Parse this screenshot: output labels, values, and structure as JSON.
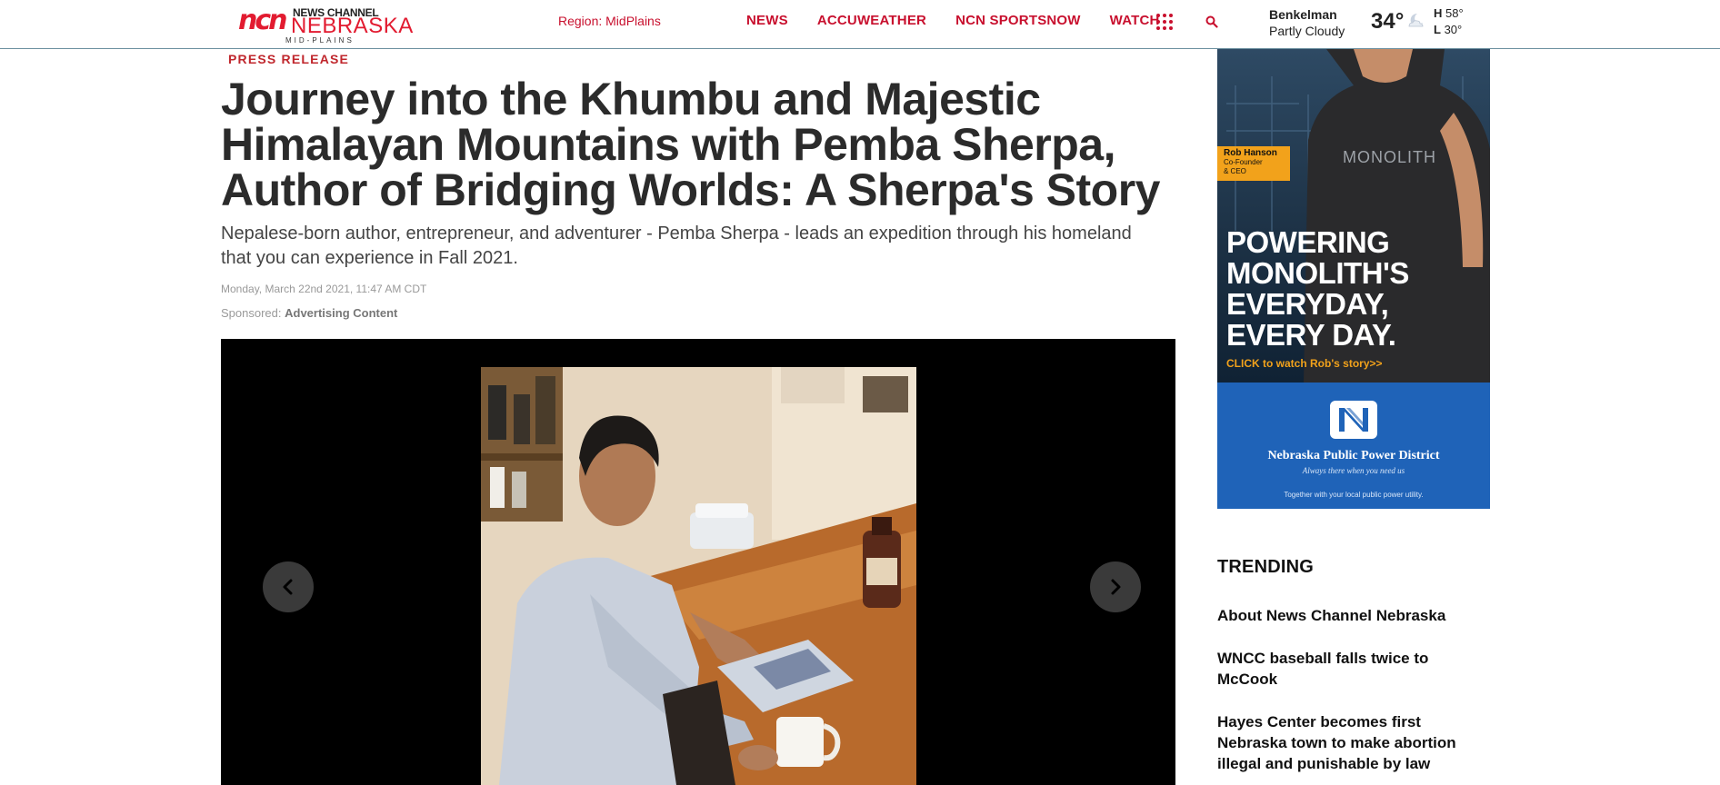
{
  "header": {
    "logo": {
      "mark": "ncn",
      "line1": "NEWS CHANNEL",
      "line2": "NEBRASKA",
      "line3": "MID-PLAINS"
    },
    "region_label": "Region: MidPlains",
    "nav": [
      "NEWS",
      "ACCUWEATHER",
      "NCN SPORTSNOW",
      "WATCH"
    ],
    "icons": {
      "apps": "grid-dots-icon",
      "search": "search-icon",
      "weather": "partly-cloudy-night-icon"
    },
    "weather": {
      "city": "Benkelman",
      "condition": "Partly Cloudy",
      "temp": "34°",
      "high": "58°",
      "low": "30°",
      "high_label": "H",
      "low_label": "L"
    }
  },
  "article": {
    "kicker": "PRESS RELEASE",
    "headline": "Journey into the Khumbu and Majestic Himalayan Mountains with Pemba Sherpa, Author of Bridging Worlds: A Sherpa's Story",
    "subhead": "Nepalese-born author, entrepreneur, and adventurer - Pemba Sherpa - leads an expedition through his homeland that you can experience in Fall 2021.",
    "date": "Monday, March 22nd 2021, 11:47 AM CDT",
    "sponsored_label": "Sponsored:",
    "sponsored_value": "Advertising Content"
  },
  "ad": {
    "person_name": "Rob Hanson",
    "person_role_1": "Co-Founder",
    "person_role_2": "& CEO",
    "shirt_text": "MONOLITH",
    "headline_1": "POWERING",
    "headline_2": "MONOLITH'S",
    "headline_3": "EVERYDAY,",
    "headline_4": "EVERY DAY.",
    "cta": "CLICK to watch Rob's story>>",
    "org_name": "Nebraska Public Power District",
    "org_tagline": "Always there when you need us",
    "org_footer": "Together with your local public power utility."
  },
  "trending": {
    "title": "TRENDING",
    "items": [
      "About News Channel Nebraska",
      "WNCC baseball falls twice to McCook",
      "Hayes Center becomes first Nebraska town to make abortion illegal and punishable by law"
    ]
  },
  "colors": {
    "brand_red": "#c8102e",
    "ad_blue": "#1f63b8",
    "ad_orange": "#f2a21b"
  }
}
